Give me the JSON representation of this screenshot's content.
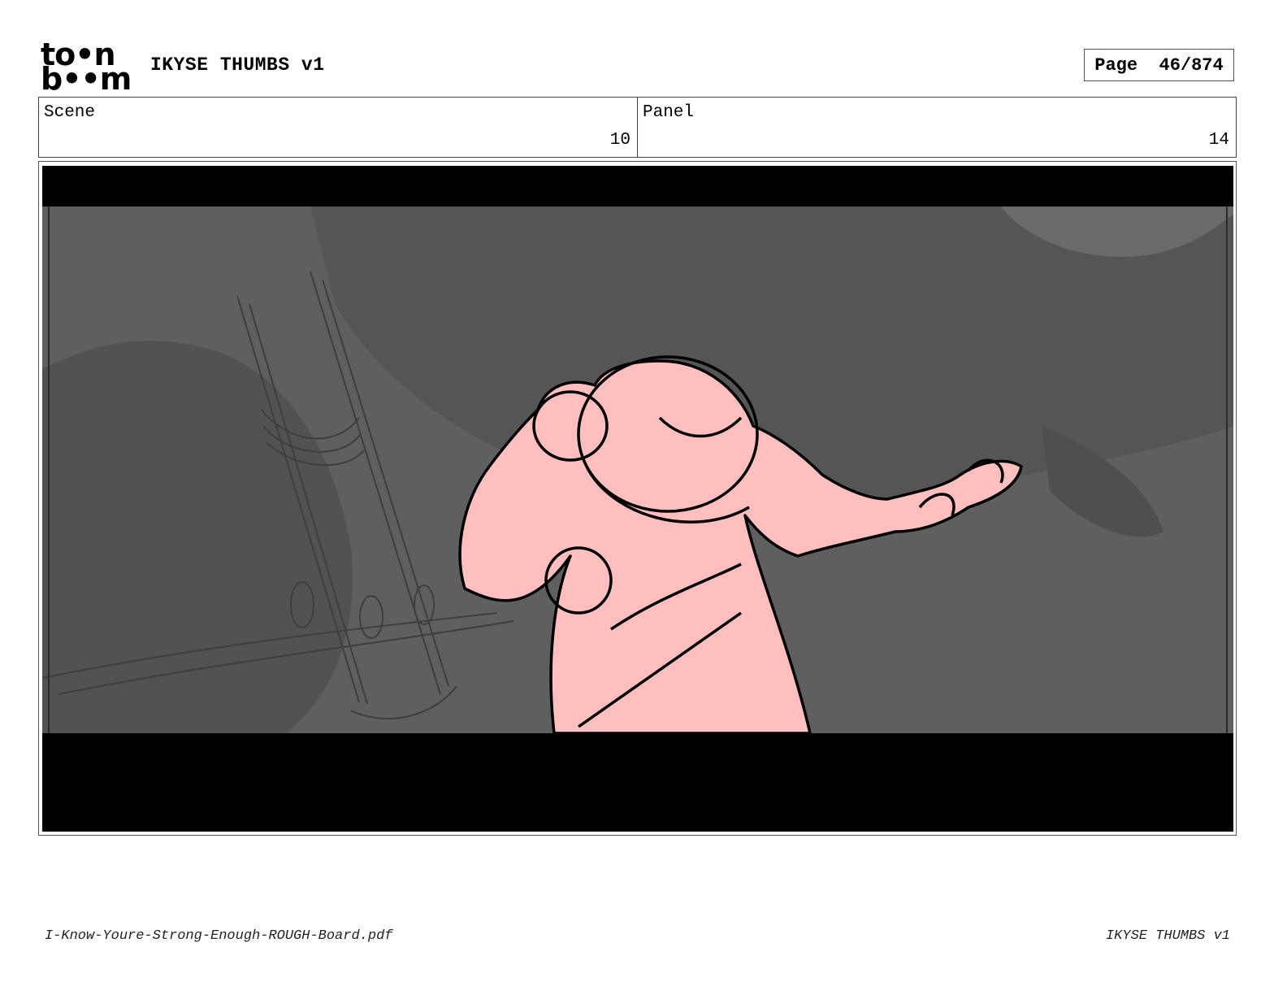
{
  "header": {
    "logo_line1": "to•n",
    "logo_line2": "b••m",
    "title": "IKYSE THUMBS v1",
    "page_label": "Page",
    "page_value": "46/874"
  },
  "info": {
    "scene_label": "Scene",
    "scene_value": "10",
    "panel_label": "Panel",
    "panel_value": "14"
  },
  "footer": {
    "filename": "I-Know-Youre-Strong-Enough-ROUGH-Board.pdf",
    "title": "IKYSE THUMBS v1"
  },
  "colors": {
    "background": "#5f5f5f",
    "figure_fill": "#ffbfbf",
    "letterbox": "#000000"
  }
}
